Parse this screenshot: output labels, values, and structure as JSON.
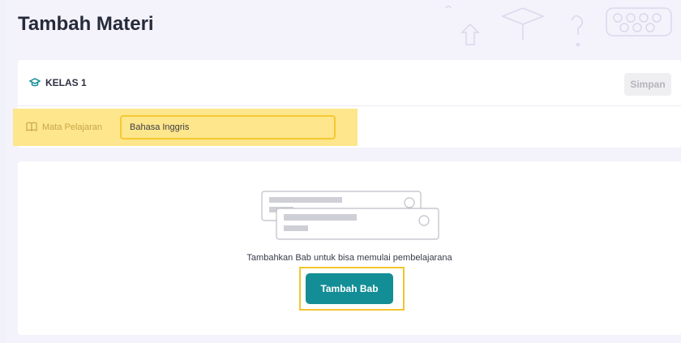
{
  "page": {
    "title": "Tambah Materi"
  },
  "header": {
    "class_label": "KELAS 1",
    "save_label": "Simpan"
  },
  "subject": {
    "label": "Mata Pelajaran",
    "value": "Bahasa Inggris"
  },
  "empty_state": {
    "message": "Tambahkan Bab untuk bisa memulai pembelajarana",
    "button_label": "Tambah Bab"
  },
  "colors": {
    "accent": "#148e96",
    "highlight": "#fde68b",
    "highlight_border": "#f4c430"
  },
  "icons": [
    "graduation-cap-icon",
    "book-icon"
  ]
}
